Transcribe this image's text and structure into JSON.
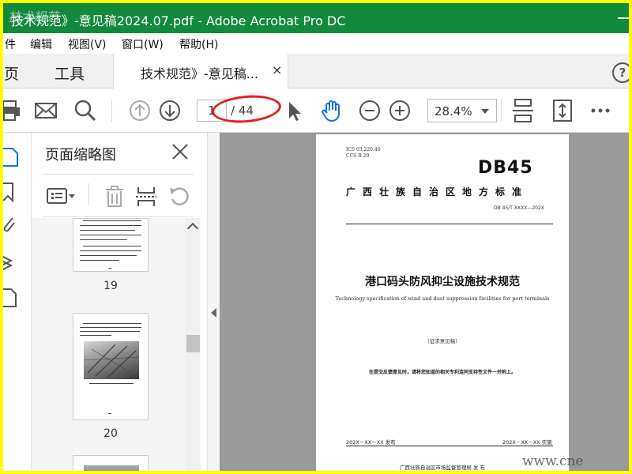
{
  "window": {
    "title": "技术规范》-意见稿2024.07.pdf - Adobe Acrobat Pro DC",
    "watermark": "技术规范"
  },
  "menu": [
    "件",
    "编辑",
    "视图(V)",
    "窗口(W)",
    "帮助(H)"
  ],
  "tabs": {
    "home": "主页",
    "tools": "工具",
    "document": "技术规范》-意见稿...",
    "close": "×",
    "help": "?"
  },
  "toolbar": {
    "current_page": "1",
    "total_pages": "/ 44",
    "zoom": "28.4%",
    "icons": [
      "print-icon",
      "email-icon",
      "search-icon",
      "page-up-icon",
      "page-down-icon",
      "select-cursor-icon",
      "hand-tool-icon",
      "zoom-out-icon",
      "zoom-in-icon",
      "scroll-mode-icon",
      "fit-page-icon",
      "more-icon"
    ]
  },
  "left_rail": {
    "icons": [
      "page-thumbnails-icon",
      "bookmarks-icon",
      "attachments-icon",
      "layers-icon",
      "page-icon"
    ]
  },
  "thumbnails_panel": {
    "title": "页面缩略图",
    "tools": [
      "options-icon",
      "delete-page-icon",
      "insert-page-icon",
      "rotate-page-icon"
    ],
    "pages": [
      {
        "number": "19"
      },
      {
        "number": "20"
      }
    ]
  },
  "document": {
    "ics": "ICS 03.220.40",
    "ccs": "CCS R 20",
    "code_big": "DB45",
    "standard_name": "广西壮族自治区地方标准",
    "standard_code": "DB 45/T XXXX—202X",
    "title_cn": "港口码头防风抑尘设施技术规范",
    "title_en": "Technology specification of wind and dust suppression facilities for port terminals",
    "draft": "（征求意见稿）",
    "note": "在提交反馈意见时，请将您知道的相关专利连同支持性文件一并附上。",
    "issue_date": "202X－XX－XX 发布",
    "impl_date": "202X－XX－XX 实施",
    "issuer": "广西壮族自治区市场监督管理局    发 布"
  },
  "site_watermark": "www.cne",
  "colors": {
    "titlebar": "#128a3c",
    "frame": "#ffff00",
    "annotation": "#e02020",
    "hand_tool": "#1473e6"
  }
}
